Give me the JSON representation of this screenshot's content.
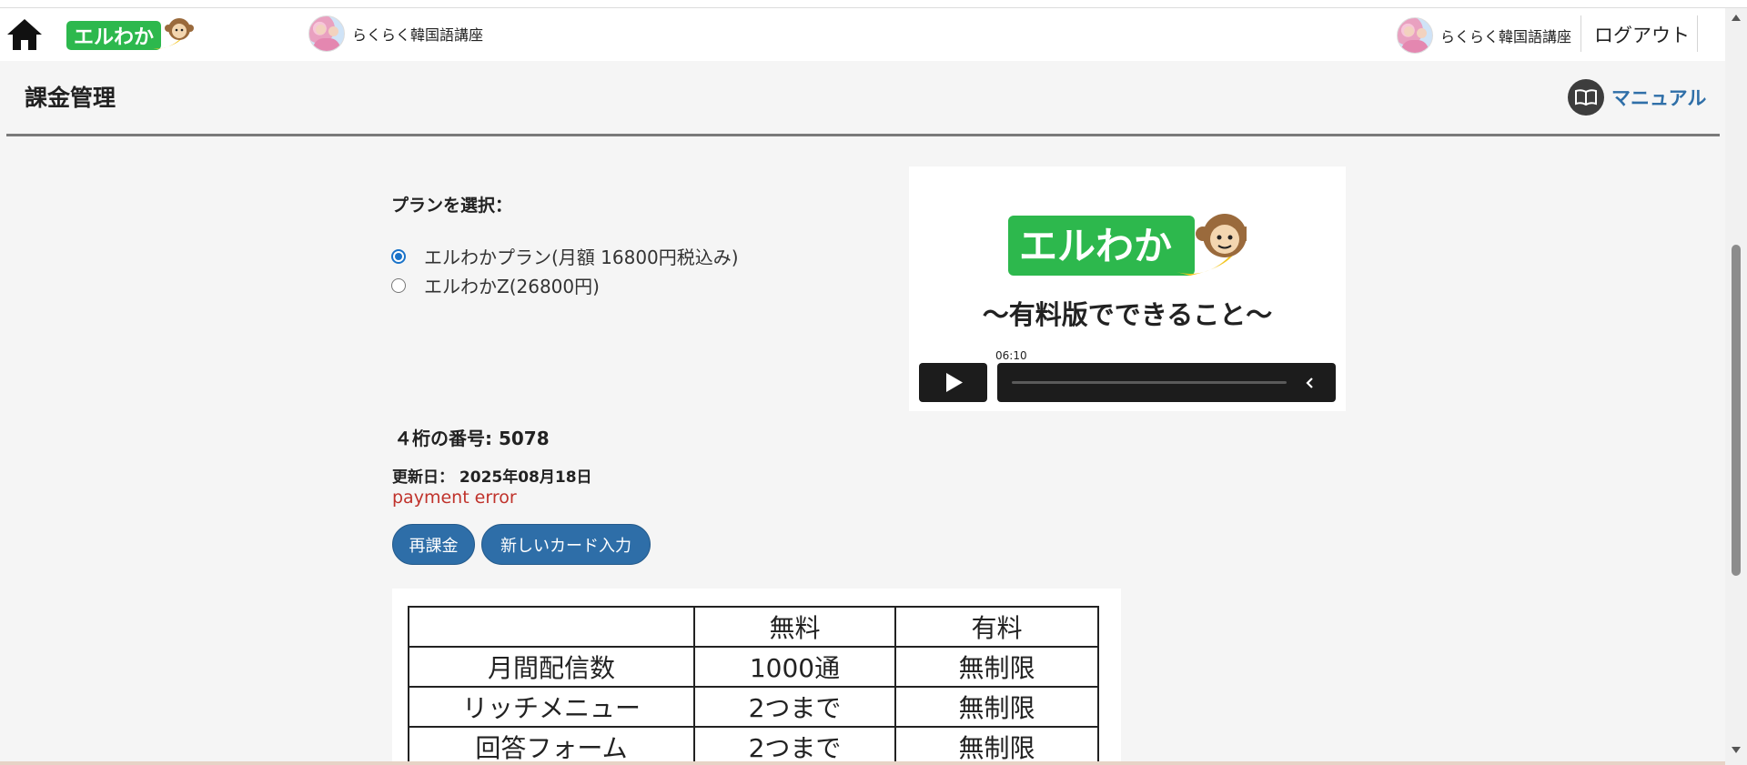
{
  "nav": {
    "channel_left": "らくらく韓国語講座",
    "channel_right": "らくらく韓国語講座",
    "logout": "ログアウト"
  },
  "page": {
    "title": "課金管理",
    "manual": "マニュアル"
  },
  "plan": {
    "heading": "プランを選択：",
    "options": [
      {
        "label": "エルわかプラン(月額 16800円税込み)",
        "selected": true
      },
      {
        "label": "エルわかZ(26800円)",
        "selected": false
      }
    ]
  },
  "video": {
    "logo_text": "エルわか",
    "title": "〜有料版でできること〜",
    "time": "06:10"
  },
  "account": {
    "four_digit": "４桁の番号: 5078",
    "updated": "更新日： 2025年08月18日",
    "error": "payment error"
  },
  "buttons": {
    "recharge": "再課金",
    "new_card": "新しいカード入力"
  },
  "logo": {
    "text": "エルわか"
  },
  "colors": {
    "brand_green": "#2db84d",
    "button_blue": "#2e6ea8",
    "error_red": "#c0322b",
    "link_blue": "#2f6fa8"
  },
  "compare_table": {
    "headers": [
      "",
      "無料",
      "有料"
    ],
    "rows": [
      [
        "月間配信数",
        "1000通",
        "無制限"
      ],
      [
        "リッチメニュー",
        "2つまで",
        "無制限"
      ],
      [
        "回答フォーム",
        "2つまで",
        "無制限"
      ]
    ]
  }
}
